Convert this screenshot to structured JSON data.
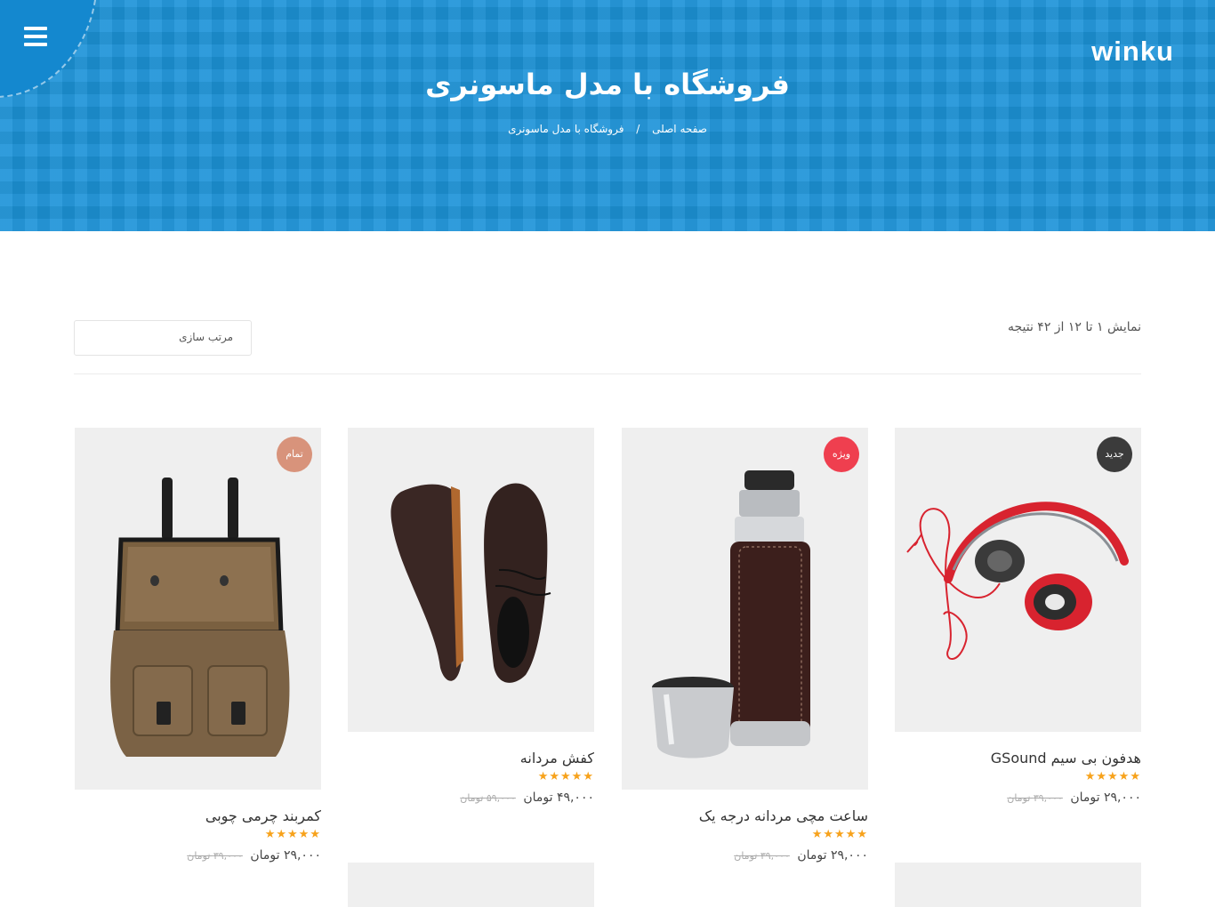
{
  "header": {
    "logo_text": "winku",
    "title": "فروشگاه با مدل ماسونری",
    "breadcrumb": {
      "home": "صفحه اصلی",
      "separator": "/",
      "current": "فروشگاه با مدل ماسونری"
    }
  },
  "toolbar": {
    "result_count": "نمایش ۱ تا ۱۲ از ۴۲ نتیجه",
    "sort_label": "مرتب سازی"
  },
  "products": [
    {
      "name": "هدفون بی سیم GSound",
      "badge": "جدید",
      "badge_color": "#3b3b3b",
      "rating": 5,
      "stars": "★★★★★",
      "price": "۲۹,۰۰۰ تومان",
      "old_price": "۳۹,۰۰۰ تومان",
      "icon": "headphones-image"
    },
    {
      "name": "ساعت مچی مردانه درجه یک",
      "badge": "ویژه",
      "badge_color": "#ef3f4f",
      "rating": 5,
      "stars": "★★★★★",
      "price": "۲۹,۰۰۰ تومان",
      "old_price": "۳۹,۰۰۰ تومان",
      "icon": "thermos-image"
    },
    {
      "name": "کفش مردانه",
      "badge": "",
      "badge_color": "",
      "rating": 5,
      "stars": "★★★★★",
      "price": "۴۹,۰۰۰ تومان",
      "old_price": "۵۹,۰۰۰ تومان",
      "icon": "shoes-image"
    },
    {
      "name": "کمربند چرمی چوبی",
      "badge": "تمام",
      "badge_color": "#d8937b",
      "rating": 5,
      "stars": "★★★★★",
      "price": "۲۹,۰۰۰ تومان",
      "old_price": "۳۹,۰۰۰ تومان",
      "icon": "bag-image"
    }
  ],
  "colors": {
    "hero": "#1c93d8",
    "star": "#f7a21b",
    "image_bg": "#efefef"
  }
}
